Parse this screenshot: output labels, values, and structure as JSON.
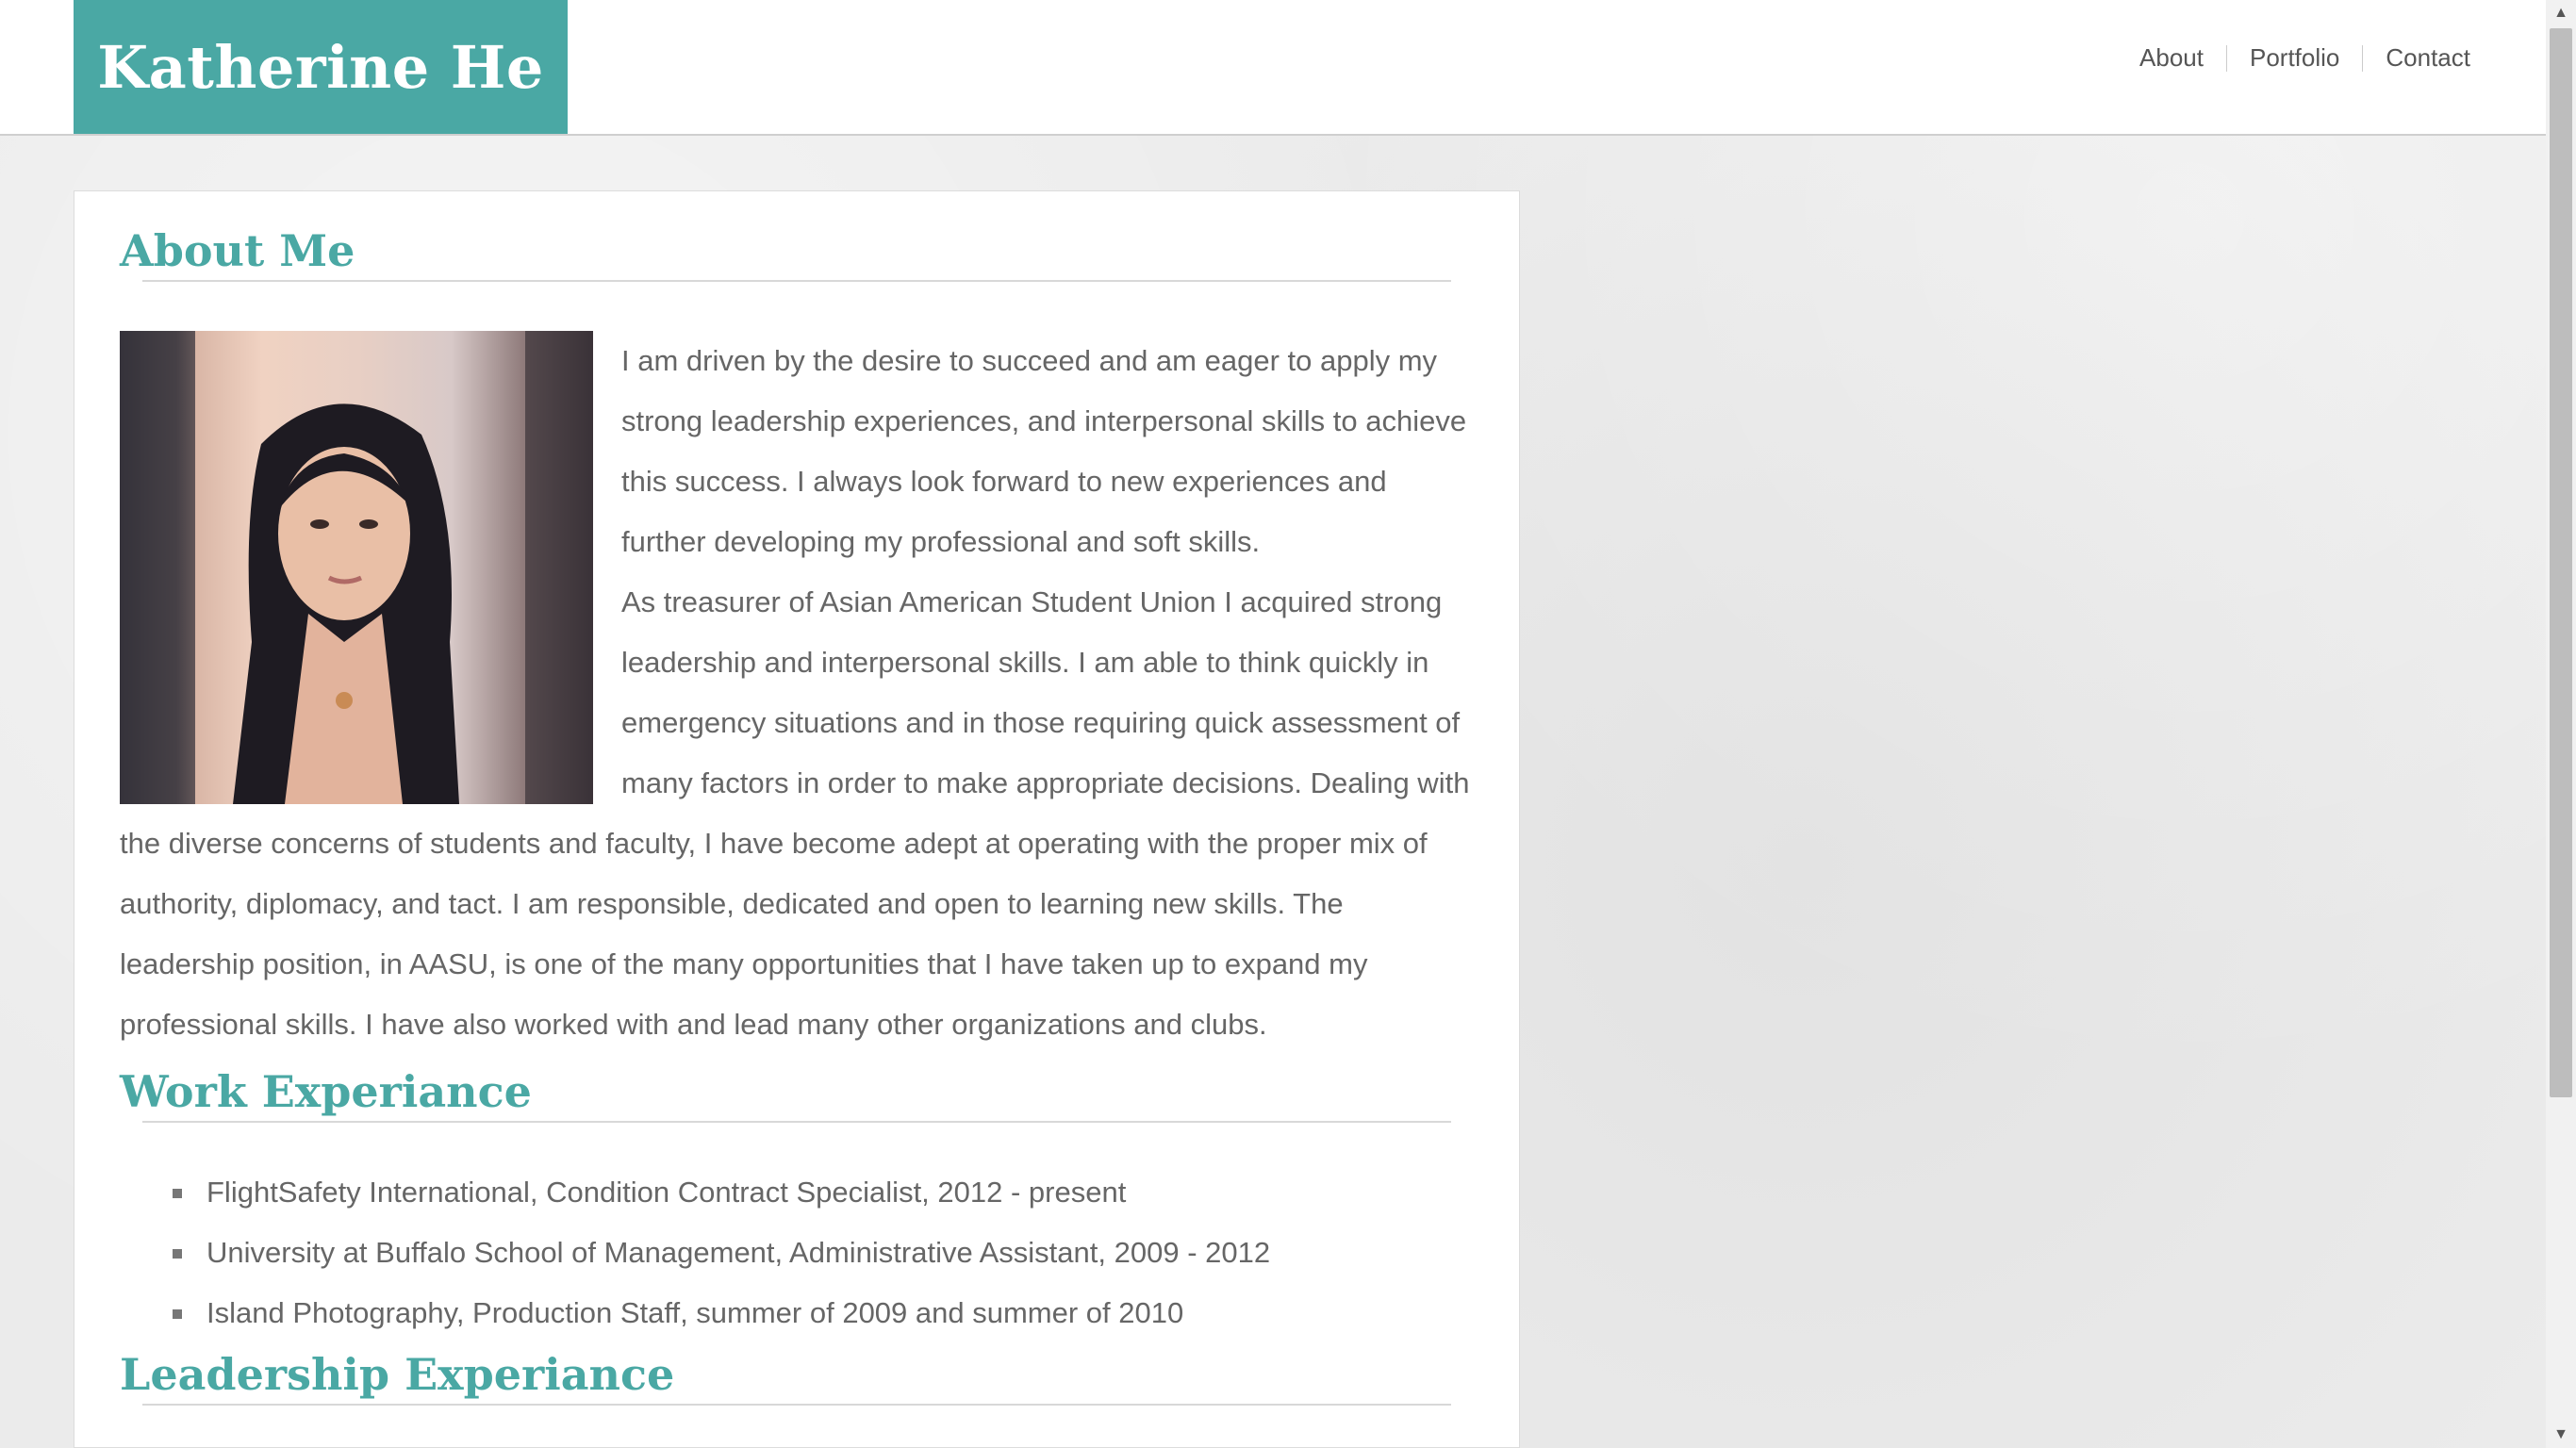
{
  "header": {
    "site_title": "Katherine He",
    "nav": [
      {
        "label": "About"
      },
      {
        "label": "Portfolio"
      },
      {
        "label": "Contact"
      }
    ]
  },
  "about": {
    "heading": "About Me",
    "photo_alt": "Portrait photo of Katherine He",
    "paragraph_1": "I am driven by the desire to succeed and am eager to apply my strong leadership experiences, and interpersonal skills to achieve this success. I always look forward to new experiences and further developing my professional and soft skills.",
    "paragraph_2": "As treasurer of Asian American Student Union I acquired strong leadership and interpersonal skills. I am able to think quickly in emergency situations and in those requiring quick assessment of many factors in order to make appropriate decisions. Dealing with the diverse concerns of students and faculty, I have become adept at operating with the proper mix of authority, diplomacy, and tact. I am responsible, dedicated and open to learning new skills. The leadership position, in AASU, is one of the many opportunities that I have taken up to expand my professional skills. I have also worked with and lead many other organizations and clubs."
  },
  "work": {
    "heading": "Work Experiance",
    "items": [
      "FlightSafety International, Condition Contract Specialist, 2012 - present",
      "University at Buffalo School of Management, Administrative Assistant, 2009 - 2012",
      "Island Photography, Production Staff, summer of 2009 and summer of 2010"
    ]
  },
  "leadership": {
    "heading": "Leadership Experiance"
  },
  "colors": {
    "accent": "#4aa8a4",
    "body_text": "#666666",
    "background": "#ebebeb"
  }
}
